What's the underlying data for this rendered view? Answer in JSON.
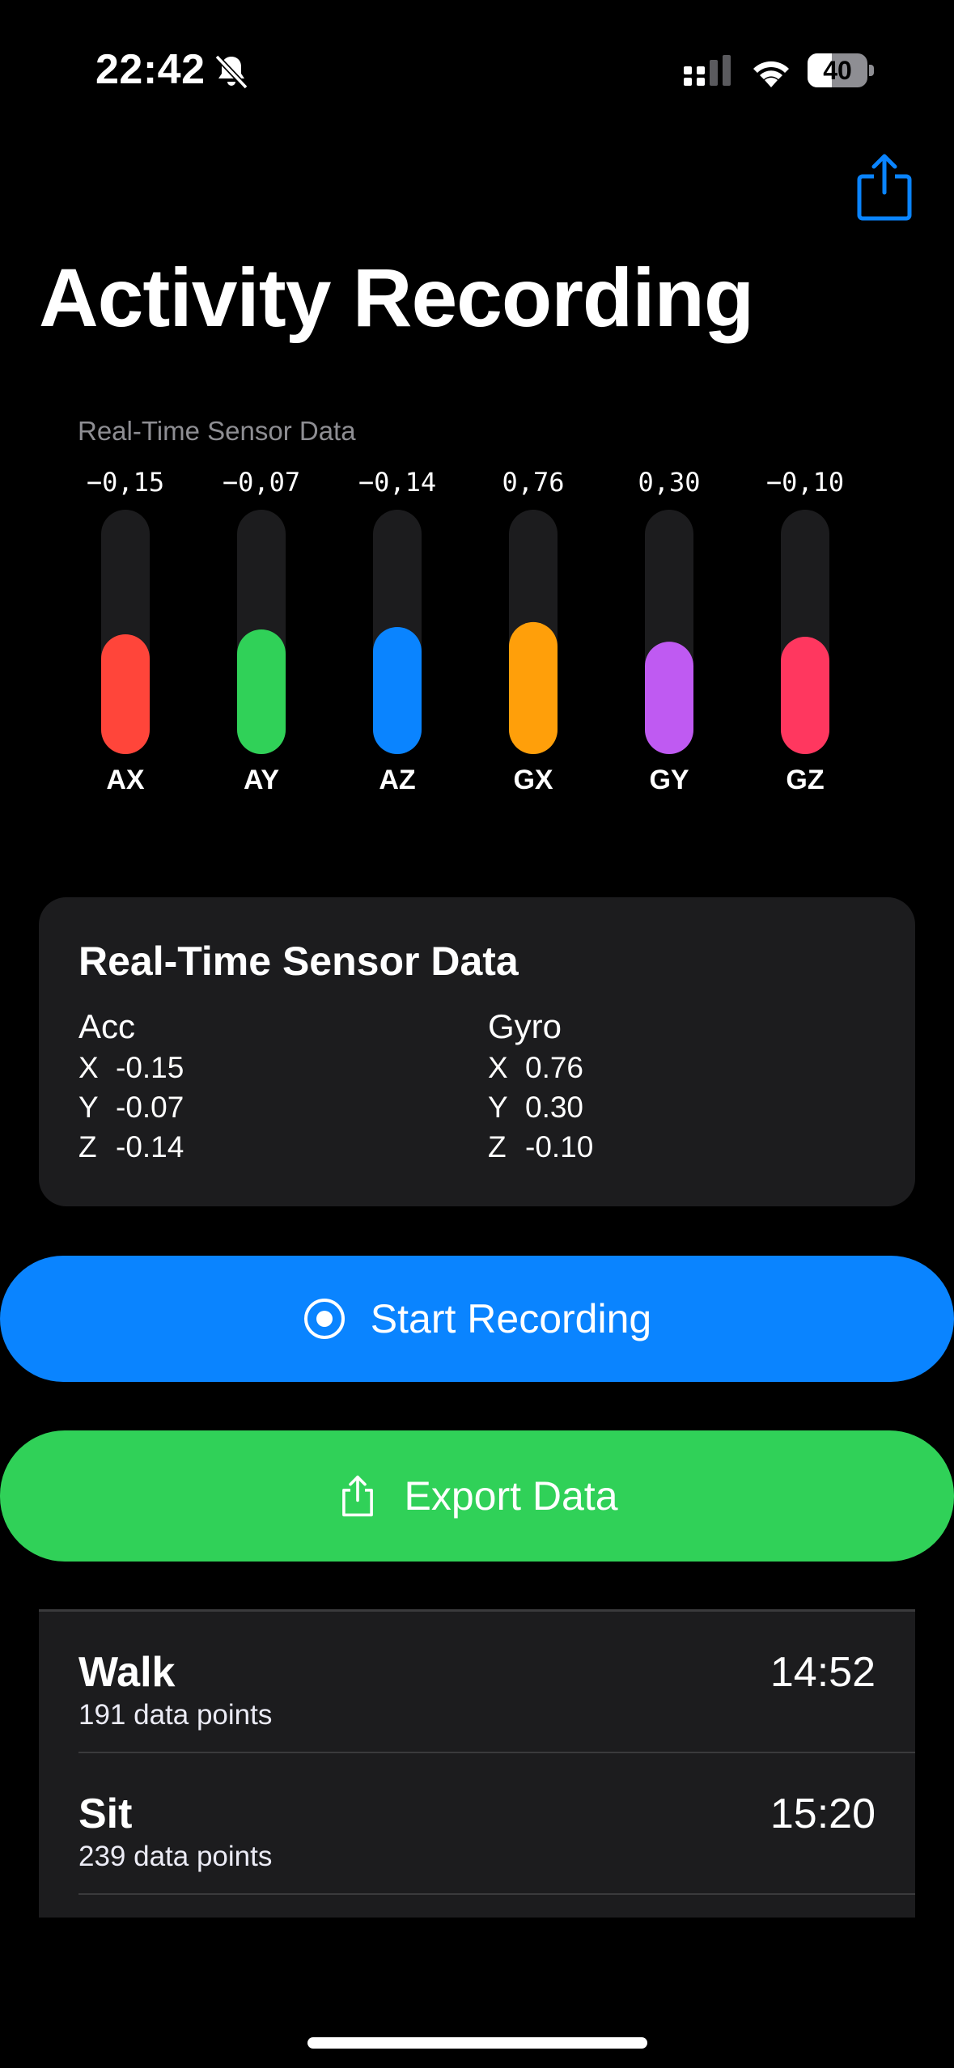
{
  "status_bar": {
    "time": "22:42",
    "battery_level": "40",
    "battery_fraction": 0.4
  },
  "header": {
    "title": "Activity Recording",
    "share_icon": "share-icon"
  },
  "chart_data": {
    "type": "bar",
    "title": "Real-Time Sensor Data",
    "categories": [
      "AX",
      "AY",
      "AZ",
      "GX",
      "GY",
      "GZ"
    ],
    "value_labels": [
      "−0,15",
      "−0,07",
      "−0,14",
      "0,76",
      "0,30",
      "−0,10"
    ],
    "values": [
      -0.15,
      -0.07,
      -0.14,
      0.76,
      0.3,
      -0.1
    ],
    "fill_fractions": [
      0.49,
      0.51,
      0.52,
      0.54,
      0.46,
      0.48
    ],
    "colors": [
      "#ff453a",
      "#30d158",
      "#0a84ff",
      "#ff9f0a",
      "#bf5af2",
      "#ff375f"
    ],
    "track_color": "#1c1c1e",
    "grid": false,
    "legend": "none"
  },
  "sensor_card": {
    "title": "Real-Time Sensor Data",
    "acc": {
      "label": "Acc",
      "rows": [
        {
          "axis": "X",
          "value": "-0.15"
        },
        {
          "axis": "Y",
          "value": "-0.07"
        },
        {
          "axis": "Z",
          "value": "-0.14"
        }
      ]
    },
    "gyro": {
      "label": "Gyro",
      "rows": [
        {
          "axis": "X",
          "value": "0.76"
        },
        {
          "axis": "Y",
          "value": "0.30"
        },
        {
          "axis": "Z",
          "value": "-0.10"
        }
      ]
    }
  },
  "buttons": {
    "start_recording": "Start Recording",
    "export_data": "Export Data"
  },
  "sessions": [
    {
      "name": "Walk",
      "points": "191 data points",
      "time": "14:52"
    },
    {
      "name": "Sit",
      "points": "239 data points",
      "time": "15:20"
    }
  ],
  "colors": {
    "accent_blue": "#0a84ff",
    "accent_green": "#30d158",
    "background": "#000000",
    "card": "#1c1c1e"
  }
}
